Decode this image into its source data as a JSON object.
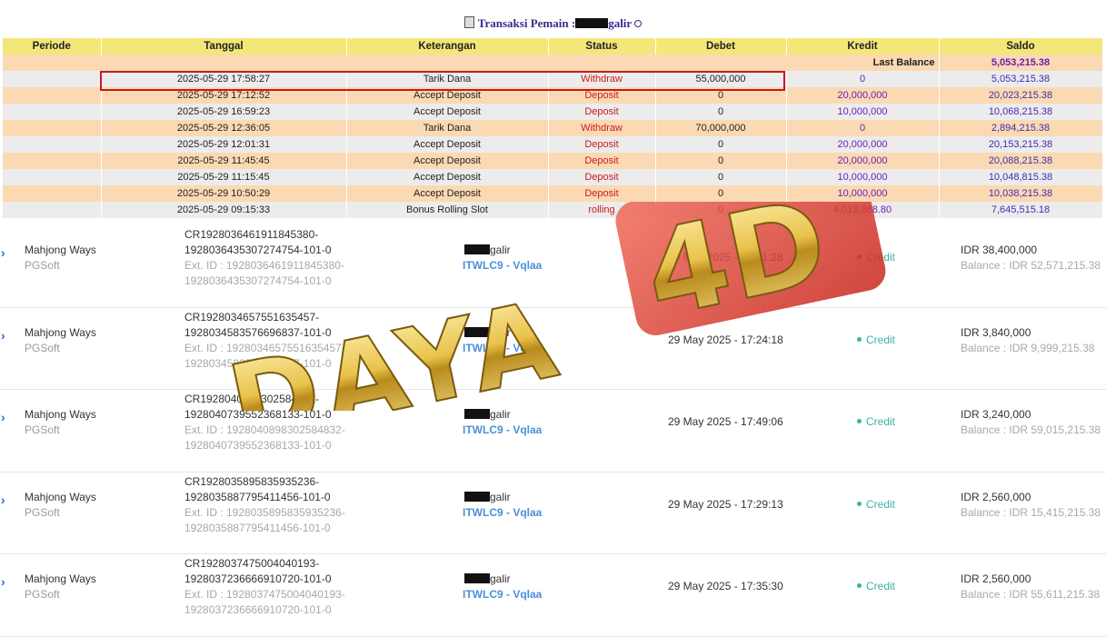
{
  "header": {
    "title_prefix": "Transaksi  Pemain :",
    "title_suffix": "galir"
  },
  "table": {
    "columns": [
      "Periode",
      "Tanggal",
      "Keterangan",
      "Status",
      "Debet",
      "Kredit",
      "Saldo"
    ],
    "last_balance_label": "Last Balance",
    "last_balance_value": "5,053,215.38",
    "rows": [
      {
        "tanggal": "2025-05-29 17:58:27",
        "keterangan": "Tarik Dana",
        "status": "Withdraw",
        "debet": "55,000,000",
        "kredit": "0",
        "saldo": "5,053,215.38"
      },
      {
        "tanggal": "2025-05-29 17:12:52",
        "keterangan": "Accept Deposit",
        "status": "Deposit",
        "debet": "0",
        "kredit": "20,000,000",
        "saldo": "20,023,215.38"
      },
      {
        "tanggal": "2025-05-29 16:59:23",
        "keterangan": "Accept Deposit",
        "status": "Deposit",
        "debet": "0",
        "kredit": "10,000,000",
        "saldo": "10,068,215.38"
      },
      {
        "tanggal": "2025-05-29 12:36:05",
        "keterangan": "Tarik Dana",
        "status": "Withdraw",
        "debet": "70,000,000",
        "kredit": "0",
        "saldo": "2,894,215.38"
      },
      {
        "tanggal": "2025-05-29 12:01:31",
        "keterangan": "Accept Deposit",
        "status": "Deposit",
        "debet": "0",
        "kredit": "20,000,000",
        "saldo": "20,153,215.38"
      },
      {
        "tanggal": "2025-05-29 11:45:45",
        "keterangan": "Accept Deposit",
        "status": "Deposit",
        "debet": "0",
        "kredit": "20,000,000",
        "saldo": "20,088,215.38"
      },
      {
        "tanggal": "2025-05-29 11:15:45",
        "keterangan": "Accept Deposit",
        "status": "Deposit",
        "debet": "0",
        "kredit": "10,000,000",
        "saldo": "10,048,815.38"
      },
      {
        "tanggal": "2025-05-29 10:50:29",
        "keterangan": "Accept Deposit",
        "status": "Deposit",
        "debet": "0",
        "kredit": "10,000,000",
        "saldo": "10,038,215.38"
      },
      {
        "tanggal": "2025-05-29 09:15:33",
        "keterangan": "Bonus Rolling Slot",
        "status": "rolling",
        "debet": "0",
        "kredit": "4,013,888.80",
        "saldo": "7,645,515.18"
      }
    ]
  },
  "games": [
    {
      "game": "Mahjong Ways",
      "provider": "PGSoft",
      "ref_line1": "CR1928036461911845380-",
      "ref_line2": "1928036435307274754-101-0",
      "ext_line1": "Ext. ID : 1928036461911845380-",
      "ext_line2": "1928036435307274754-101-0",
      "player_suffix": "galir",
      "agent": "ITWLC9 - Vqlaa",
      "time": "29 May 2025 - 17:31:28",
      "type": "Credit",
      "amount": "IDR 38,400,000",
      "balance": "Balance : IDR 52,571,215.38"
    },
    {
      "game": "Mahjong Ways",
      "provider": "PGSoft",
      "ref_line1": "CR1928034657551635457-",
      "ref_line2": "1928034583576696837-101-0",
      "ext_line1": "Ext. ID : 1928034657551635457-",
      "ext_line2": "1928034583576696837-101-0",
      "player_suffix": "galir",
      "agent": "ITWLC9 - Vqlaa",
      "time": "29 May 2025 - 17:24:18",
      "type": "Credit",
      "amount": "IDR 3,840,000",
      "balance": "Balance : IDR 9,999,215.38"
    },
    {
      "game": "Mahjong Ways",
      "provider": "PGSoft",
      "ref_line1": "CR1928040898302584832-",
      "ref_line2": "1928040739552368133-101-0",
      "ext_line1": "Ext. ID : 1928040898302584832-",
      "ext_line2": "1928040739552368133-101-0",
      "player_suffix": "galir",
      "agent": "ITWLC9 - Vqlaa",
      "time": "29 May 2025 - 17:49:06",
      "type": "Credit",
      "amount": "IDR 3,240,000",
      "balance": "Balance : IDR 59,015,215.38"
    },
    {
      "game": "Mahjong Ways",
      "provider": "PGSoft",
      "ref_line1": "CR1928035895835935236-",
      "ref_line2": "1928035887795411456-101-0",
      "ext_line1": "Ext. ID : 1928035895835935236-",
      "ext_line2": "1928035887795411456-101-0",
      "player_suffix": "galir",
      "agent": "ITWLC9 - Vqlaa",
      "time": "29 May 2025 - 17:29:13",
      "type": "Credit",
      "amount": "IDR 2,560,000",
      "balance": "Balance : IDR 15,415,215.38"
    },
    {
      "game": "Mahjong Ways",
      "provider": "PGSoft",
      "ref_line1": "CR1928037475004040193-",
      "ref_line2": "1928037236666910720-101-0",
      "ext_line1": "Ext. ID : 1928037475004040193-",
      "ext_line2": "1928037236666910720-101-0",
      "player_suffix": "galir",
      "agent": "ITWLC9 - Vqlaa",
      "time": "29 May 2025 - 17:35:30",
      "type": "Credit",
      "amount": "IDR 2,560,000",
      "balance": "Balance : IDR 55,611,215.38"
    }
  ],
  "watermark": {
    "word": "DAYA",
    "number": "4D"
  },
  "colors": {
    "header_bg": "#f3e77a",
    "row_peach": "#fbd9b3",
    "row_grey": "#ececec",
    "status_red": "#c81c1c",
    "kredit_purple": "#6a1fb3",
    "credit_teal": "#3bb3a3",
    "agent_blue": "#4a90d9",
    "highlight_red": "#c8191d"
  },
  "icons": [
    "document-icon",
    "info-dot-icon",
    "chevron-right-icon"
  ]
}
